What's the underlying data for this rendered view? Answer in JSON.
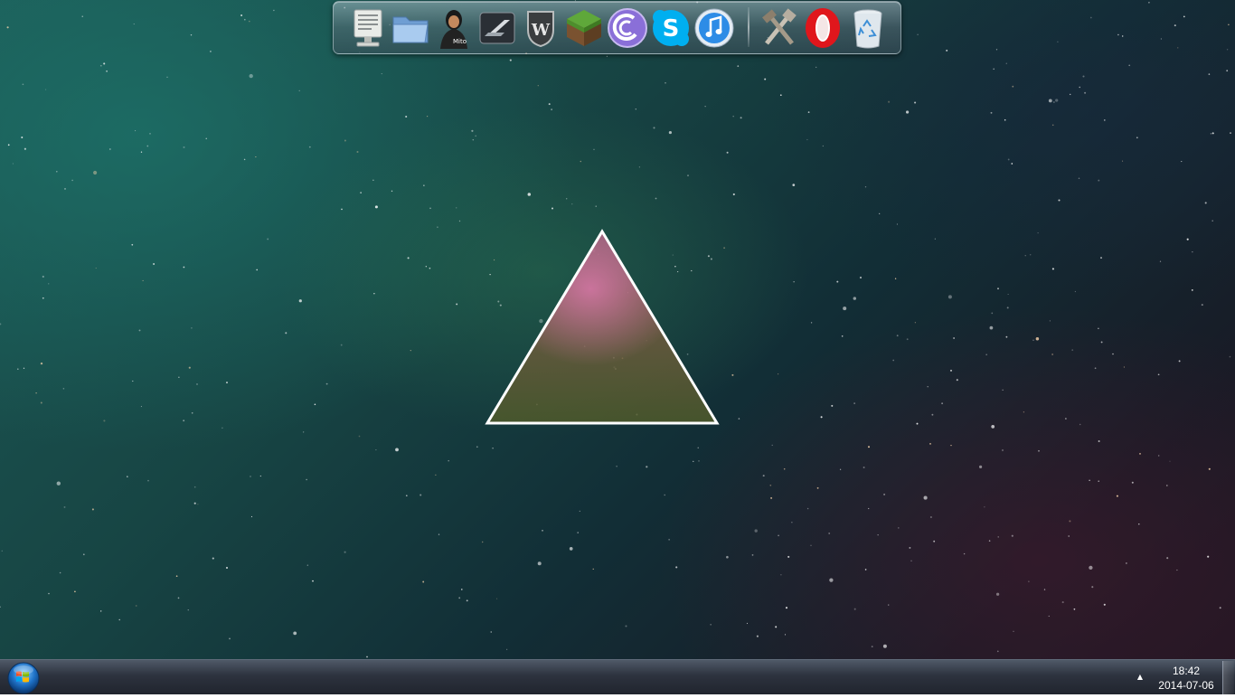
{
  "desktop": {
    "wallpaper": "space nebula with triangle"
  },
  "dock": {
    "items": [
      {
        "name": "computer",
        "icon": "computer-icon"
      },
      {
        "name": "folder",
        "icon": "folder-icon"
      },
      {
        "name": "avatar app",
        "icon": "avatar-icon"
      },
      {
        "name": "need for speed",
        "icon": "racing-game-icon"
      },
      {
        "name": "world of tanks",
        "icon": "tank-shield-icon"
      },
      {
        "name": "minecraft",
        "icon": "grass-block-icon"
      },
      {
        "name": "bittorrent",
        "icon": "torrent-icon"
      },
      {
        "name": "skype",
        "icon": "skype-icon"
      },
      {
        "name": "itunes",
        "icon": "music-note-icon"
      },
      {
        "name": "tools",
        "icon": "tools-icon"
      },
      {
        "name": "opera",
        "icon": "opera-icon"
      },
      {
        "name": "recycle bin",
        "icon": "recycle-bin-icon"
      }
    ]
  },
  "taskbar": {
    "start_icon": "windows-orb-icon",
    "tray_arrow": "▲",
    "clock": {
      "time": "18:42",
      "date": "2014-07-06"
    }
  },
  "colors": {
    "skype": "#00aff0",
    "opera": "#e0161c",
    "itunes": "#2d8ce6",
    "bittorrent": "#8a6fd8"
  }
}
